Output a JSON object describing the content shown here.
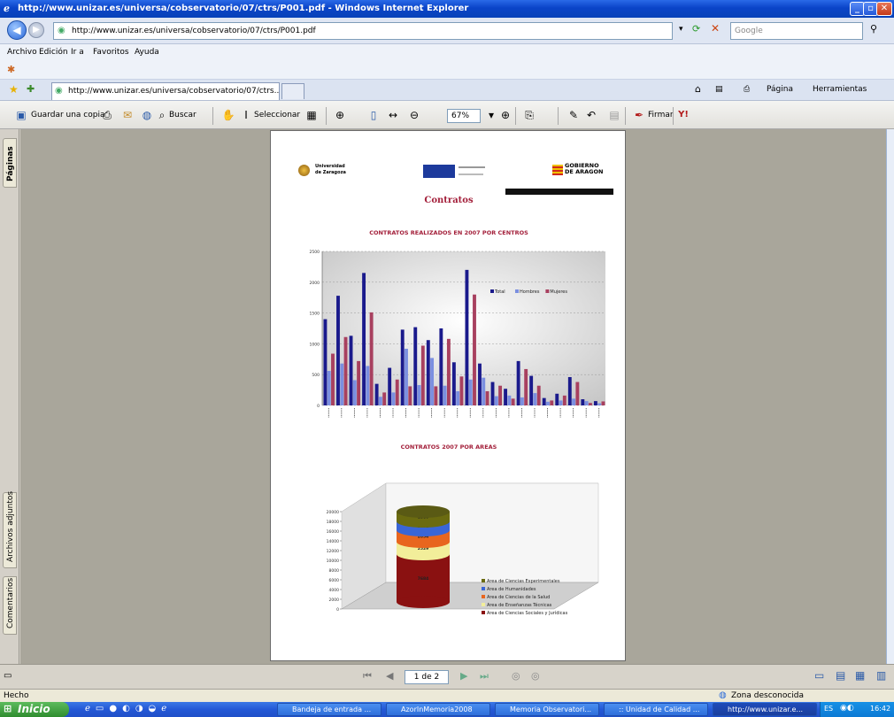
{
  "window": {
    "title": "http://www.unizar.es/universa/cobservatorio/07/ctrs/P001.pdf - Windows Internet Explorer"
  },
  "address": {
    "url": "http://www.unizar.es/universa/cobservatorio/07/ctrs/P001.pdf",
    "search_placeholder": "Google"
  },
  "menu": [
    "Archivo",
    "Edición",
    "Ir a",
    "Favoritos",
    "Ayuda"
  ],
  "tab": {
    "label": "http://www.unizar.es/universa/cobservatorio/07/ctrs..."
  },
  "tab_tools": {
    "page": "Página",
    "tools": "Herramientas"
  },
  "acrobat": {
    "save_copy": "Guardar una copia",
    "search": "Buscar",
    "select": "Seleccionar",
    "zoom": "67%",
    "sign": "Firmar"
  },
  "side_tabs": [
    "Páginas",
    "Archivos adjuntos",
    "Comentarios"
  ],
  "pdf": {
    "logo_left": [
      "Universidad",
      "de Zaragoza"
    ],
    "logo_right": [
      "GOBIERNO",
      "DE ARAGON"
    ],
    "title": "Contratos",
    "chart1_title": "CONTRATOS REALIZADOS EN 2007 POR CENTROS",
    "chart2_title": "CONTRATOS 2007 POR AREAS"
  },
  "chart_data": [
    {
      "type": "bar",
      "title": "CONTRATOS REALIZADOS EN 2007 POR CENTROS",
      "ylim": [
        0,
        2500
      ],
      "yticks": [
        "0",
        "500",
        "1000",
        "1500",
        "2000",
        "2500"
      ],
      "legend_position": "right",
      "series": [
        {
          "name": "Total",
          "color": "#1a1a8c",
          "values": [
            1400,
            1780,
            1130,
            2150,
            350,
            610,
            1230,
            1270,
            1060,
            1250,
            700,
            2200,
            680,
            380,
            270,
            720,
            480,
            120,
            190,
            460,
            100,
            70
          ]
        },
        {
          "name": "Hombres",
          "color": "#7b8fe0",
          "values": [
            560,
            680,
            410,
            640,
            140,
            210,
            920,
            330,
            770,
            320,
            230,
            420,
            450,
            150,
            160,
            130,
            200,
            60,
            80,
            110,
            70,
            35
          ]
        },
        {
          "name": "Mujeres",
          "color": "#a8405f",
          "values": [
            840,
            1110,
            720,
            1510,
            210,
            420,
            310,
            970,
            310,
            1080,
            470,
            1800,
            230,
            320,
            110,
            590,
            320,
            80,
            160,
            380,
            40,
            65
          ]
        }
      ]
    },
    {
      "type": "area",
      "title": "CONTRATOS 2007 POR AREAS",
      "ylim": [
        0,
        20000
      ],
      "yticks": [
        "0",
        "2000",
        "4000",
        "6000",
        "8000",
        "10000",
        "12000",
        "14000",
        "16000",
        "18000",
        "20000"
      ],
      "legend_position": "right",
      "series": [
        {
          "name": "Area de Ciencias Experimentales",
          "color": "#6b6b10",
          "label": "1860"
        },
        {
          "name": "Area de Humanidades",
          "color": "#3a66d6",
          "label": "2002"
        },
        {
          "name": "Area de Ciencias de la Salud",
          "color": "#e8661e",
          "label": "2054"
        },
        {
          "name": "Area de Enseñanzas Técnicas",
          "color": "#f2ee9a",
          "label": "2529"
        },
        {
          "name": "Area de Ciencias Sociales y Jurídicas",
          "color": "#8a1111",
          "label": "7684"
        }
      ]
    }
  ],
  "nav": {
    "page": "1 de 2"
  },
  "status": {
    "left": "Hecho",
    "zone": "Zona desconocida"
  },
  "taskbar": {
    "start": "Inicio",
    "tasks": [
      "Bandeja de entrada ...",
      "AzorInMemoria2008",
      "Memoria Observatori...",
      ":: Unidad de Calidad ...",
      "http://www.unizar.e..."
    ],
    "lang": "ES",
    "time": "16:42"
  }
}
